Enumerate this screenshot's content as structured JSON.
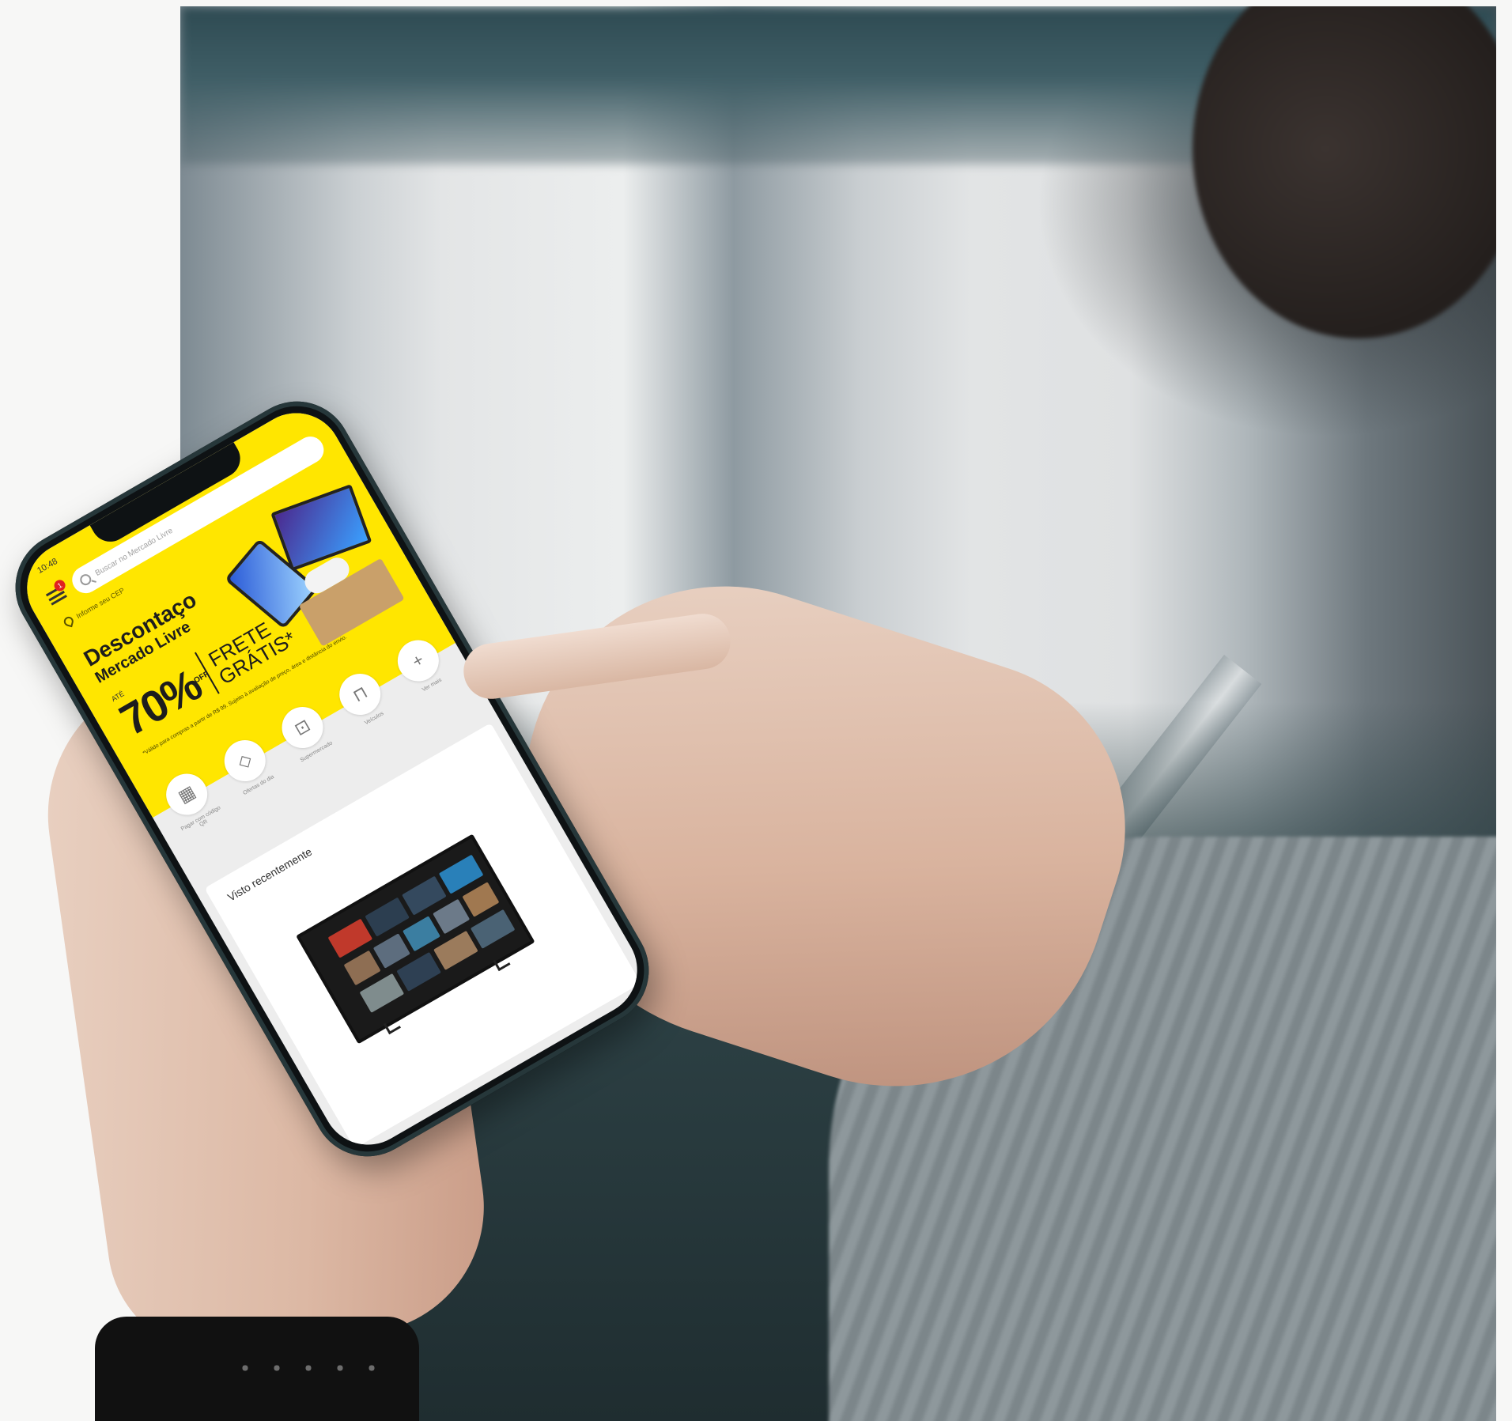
{
  "status": {
    "time": "10:48"
  },
  "header": {
    "notification_count": "1",
    "search_placeholder": "Buscar no Mercado Livre",
    "location_text": "Informe seu CEP"
  },
  "banner": {
    "title_line1": "Descontaço",
    "title_line2": "Mercado Livre",
    "ate": "ATÉ",
    "discount": "70%",
    "off": "OFF",
    "frete_line1": "FRETE",
    "frete_line2": "GRÁTIS*",
    "fine_print": "*Válido para compras a partir de R$ 99. Sujeito à avaliação de preço, área e distância do envio."
  },
  "shortcuts": [
    {
      "label": "Pagar com código QR",
      "icon": "qr-code-icon"
    },
    {
      "label": "Ofertas do dia",
      "icon": "tag-icon"
    },
    {
      "label": "Supermercado",
      "icon": "cart-icon"
    },
    {
      "label": "Veículos",
      "icon": "car-icon"
    },
    {
      "label": "Ver mais",
      "icon": "plus-icon"
    }
  ],
  "recent": {
    "title": "Visto recentemente"
  },
  "colors": {
    "brand_yellow": "#ffe600",
    "badge_red": "#e02020"
  }
}
